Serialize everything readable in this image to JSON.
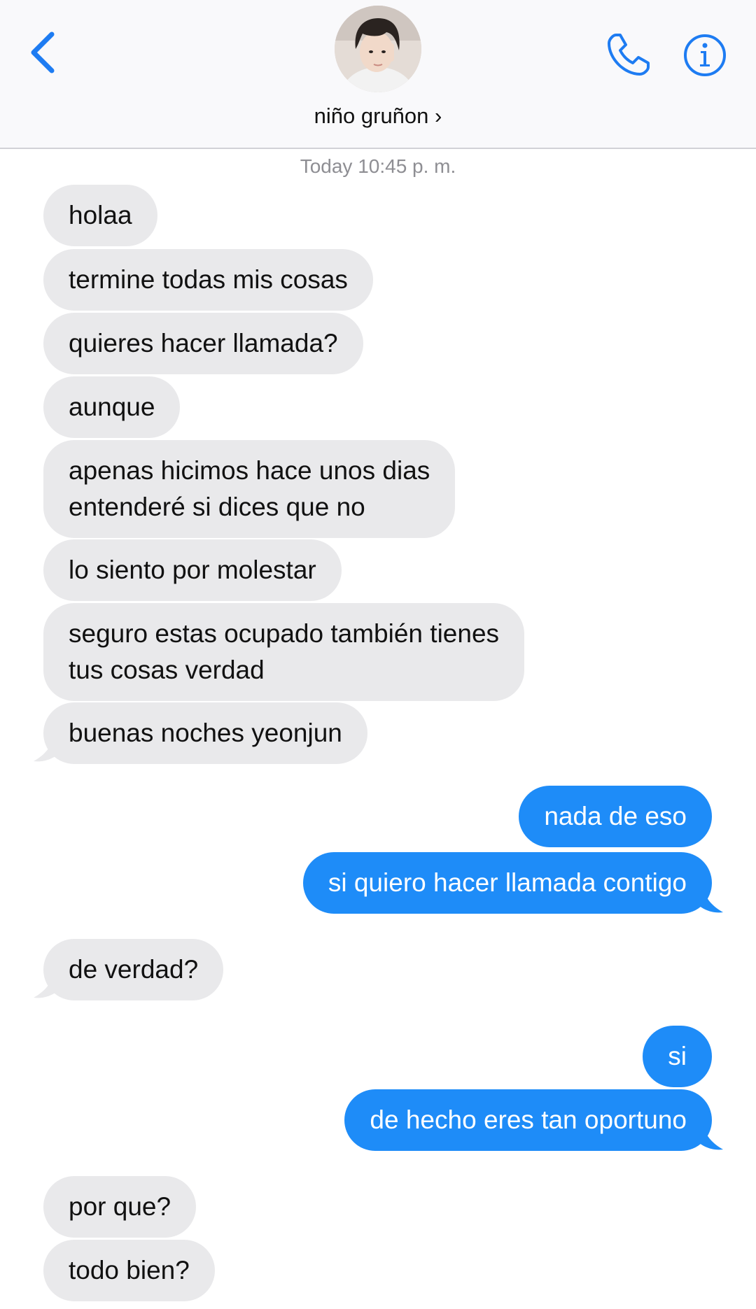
{
  "header": {
    "contact_name": "niño gruñon ›",
    "back_icon": "chevron-left-icon",
    "call_icon": "phone-icon",
    "info_icon": "info-icon",
    "accent_color": "#1e7cf2"
  },
  "conversation": {
    "timestamp_day": "Today",
    "timestamp_time": "10:45 p. m.",
    "messages": [
      {
        "side": "in",
        "text": "holaa"
      },
      {
        "side": "in",
        "text": "termine todas mis cosas"
      },
      {
        "side": "in",
        "text": "quieres hacer llamada?"
      },
      {
        "side": "in",
        "text": "aunque"
      },
      {
        "side": "in",
        "line1": "apenas hicimos hace unos dias",
        "line2": "entenderé si dices que no"
      },
      {
        "side": "in",
        "text": "lo siento por molestar"
      },
      {
        "side": "in",
        "line1": "seguro estas ocupado también tienes",
        "line2": "tus cosas verdad"
      },
      {
        "side": "in",
        "text": "buenas noches yeonjun"
      },
      {
        "side": "out",
        "text": "nada de eso"
      },
      {
        "side": "out",
        "text": "si quiero hacer llamada contigo"
      },
      {
        "side": "in",
        "text": "de verdad?"
      },
      {
        "side": "out",
        "text": "si"
      },
      {
        "side": "out",
        "text": "de hecho eres tan oportuno"
      },
      {
        "side": "in",
        "text": "por que?"
      },
      {
        "side": "in",
        "text": "todo bien?"
      }
    ]
  },
  "colors": {
    "incoming_bubble": "#e9e9eb",
    "outgoing_bubble": "#1e8cf8",
    "timestamp_text": "#8e8e93"
  }
}
